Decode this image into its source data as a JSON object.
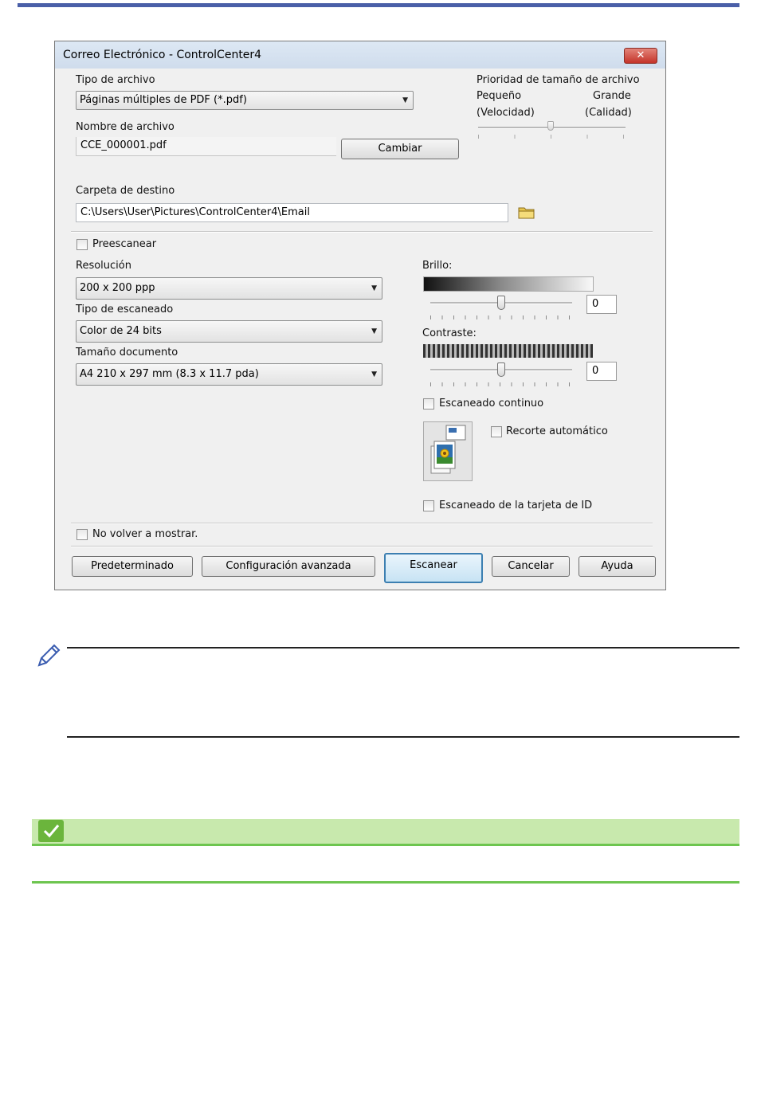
{
  "dialog": {
    "title": "Correo Electrónico - ControlCenter4",
    "close_icon": "close-icon"
  },
  "file_type": {
    "label": "Tipo de archivo",
    "value": "Páginas múltiples de PDF (*.pdf)"
  },
  "file_size_priority": {
    "label": "Prioridad de tamaño de archivo",
    "small": "Pequeño",
    "large": "Grande",
    "speed": "(Velocidad)",
    "quality": "(Calidad)",
    "level": 0.5
  },
  "file_name": {
    "label": "Nombre de archivo",
    "value": "CCE_000001.pdf",
    "change_button": "Cambiar"
  },
  "destination": {
    "label": "Carpeta de destino",
    "value": "C:\\Users\\User\\Pictures\\ControlCenter4\\Email",
    "folder_icon": "folder-icon"
  },
  "prescan": {
    "label": "Preescanear",
    "checked": false
  },
  "resolution": {
    "label": "Resolución",
    "value": "200 x 200 ppp"
  },
  "scan_type": {
    "label": "Tipo de escaneado",
    "value": "Color de 24 bits"
  },
  "doc_size": {
    "label": "Tamaño documento",
    "value": "A4 210 x 297 mm (8.3 x 11.7 pda)"
  },
  "brightness": {
    "label": "Brillo:",
    "value": "0",
    "level": 0.5
  },
  "contrast": {
    "label": "Contraste:",
    "value": "0",
    "level": 0.5
  },
  "continuous_scan": {
    "label": "Escaneado continuo",
    "checked": false
  },
  "auto_crop": {
    "label": "Recorte automático",
    "checked": false,
    "icon": "auto-crop-illustration-icon"
  },
  "id_card_scan": {
    "label": "Escaneado de la tarjeta de ID",
    "checked": false
  },
  "dont_show": {
    "label": "No volver a mostrar.",
    "checked": false
  },
  "buttons": {
    "default": "Predeterminado",
    "advanced": "Configuración avanzada",
    "scan": "Escanear",
    "cancel": "Cancelar",
    "help": "Ayuda"
  },
  "colors": {
    "top_bar": "#4a5fa8",
    "note_green_bar": "#c8e9ad",
    "note_green_line": "#6dc54f",
    "check_green": "#6bb53c"
  },
  "icons": {
    "note": "pencil-icon",
    "related": "checkmark-icon"
  }
}
